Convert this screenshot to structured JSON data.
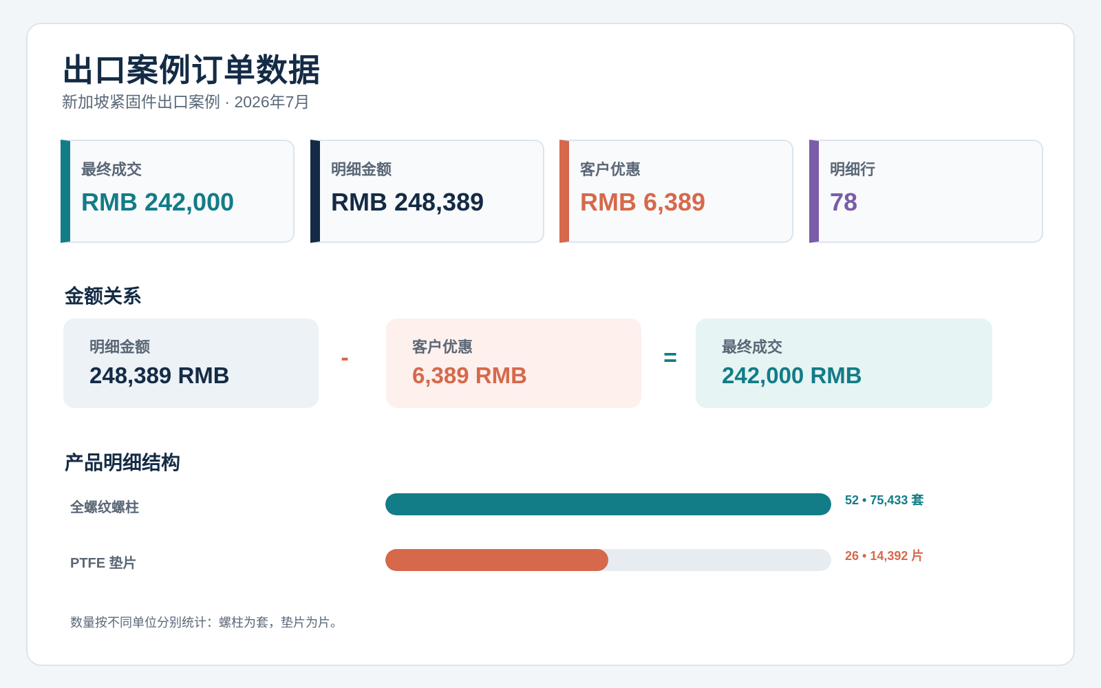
{
  "header": {
    "title": "出口案例订单数据",
    "subtitle": "新加坡紧固件出口案例 · 2026年7月"
  },
  "kpis": [
    {
      "label": "最终成交",
      "value": "RMB 242,000",
      "color": "#127c87"
    },
    {
      "label": "明细金额",
      "value": "RMB 248,389",
      "color": "#142b45"
    },
    {
      "label": "客户优惠",
      "value": "RMB 6,389",
      "color": "#d6694b"
    },
    {
      "label": "明细行",
      "value": "78",
      "color": "#7a5ca8"
    }
  ],
  "relation": {
    "title": "金额关系",
    "detail": {
      "label": "明细金额",
      "value": "248,389 RMB"
    },
    "minus": "-",
    "discount": {
      "label": "客户优惠",
      "value": "6,389 RMB"
    },
    "equals": "=",
    "final": {
      "label": "最终成交",
      "value": "242,000 RMB"
    }
  },
  "products": {
    "title": "产品明细结构",
    "items": [
      {
        "label": "全螺纹螺柱",
        "meta": "52 • 75,433 套",
        "lines": 52,
        "quantity": 75433,
        "unit": "套",
        "fraction": 1.0,
        "color": "#127c87"
      },
      {
        "label": "PTFE 垫片",
        "meta": "26 • 14,392 片",
        "lines": 26,
        "quantity": 14392,
        "unit": "片",
        "fraction": 0.5,
        "color": "#d6694b"
      }
    ]
  },
  "footnote": "数量按不同单位分别统计：螺柱为套，垫片为片。",
  "colors": {
    "teal": "#127c87",
    "navy": "#142b45",
    "orange": "#d6694b",
    "purple": "#7a5ca8",
    "relation_detail_bg": "#edf2f6",
    "relation_discount_bg": "#fdf0ed",
    "relation_final_bg": "#e6f4f3"
  }
}
